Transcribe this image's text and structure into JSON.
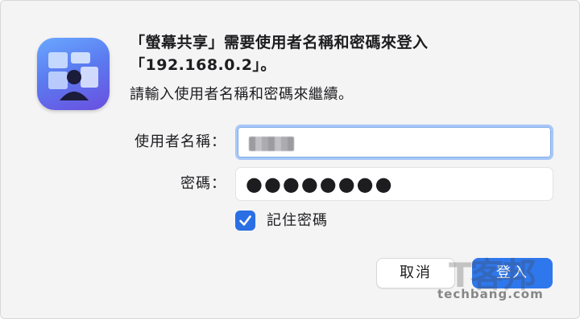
{
  "dialog": {
    "title_line1": "「螢幕共享」需要使用者名稱和密碼來登入",
    "title_line2": "「192.168.0.2」。",
    "subtitle": "請輸入使用者名稱和密碼來繼續。"
  },
  "form": {
    "username_label": "使用者名稱：",
    "username_value": "",
    "password_label": "密碼：",
    "password_value": "●●●●●●●●",
    "remember_label": "記住密碼",
    "remember_checked": true
  },
  "buttons": {
    "cancel": "取消",
    "login": "登入"
  },
  "watermark": {
    "glyph": "T客邦",
    "text": "techbang.com"
  },
  "colors": {
    "accent": "#2f77ec",
    "focus_ring": "#a8c8f6",
    "background": "#f4f4f5"
  },
  "icons": {
    "app": "screen-sharing-app-icon",
    "checkbox": "checkmark-icon"
  }
}
